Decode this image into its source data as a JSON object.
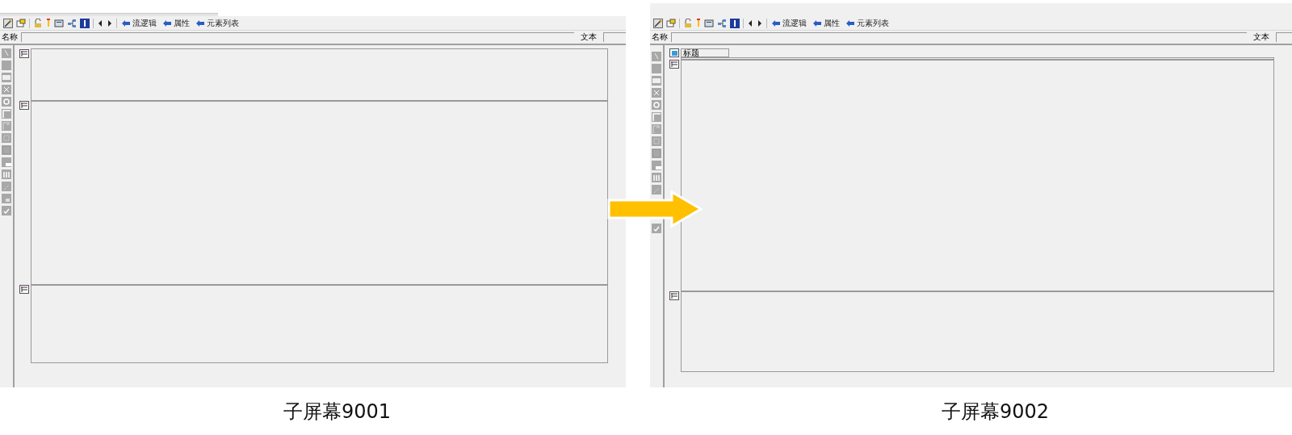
{
  "panels": [
    {
      "toolbar": {
        "buttons": [
          "流逻辑",
          "属性",
          "元素列表"
        ]
      },
      "name_label": "名称",
      "text_label": "文本",
      "caption": "子屏幕9001",
      "sections": [
        {
          "kind": "header"
        },
        {
          "kind": "body"
        },
        {
          "kind": "footer"
        }
      ]
    },
    {
      "toolbar": {
        "buttons": [
          "流逻辑",
          "属性",
          "元素列表"
        ]
      },
      "name_label": "名称",
      "text_label": "文本",
      "title_tab": "标题",
      "caption": "子屏幕9002",
      "sections": [
        {
          "kind": "header"
        },
        {
          "kind": "body"
        },
        {
          "kind": "footer"
        }
      ]
    }
  ]
}
